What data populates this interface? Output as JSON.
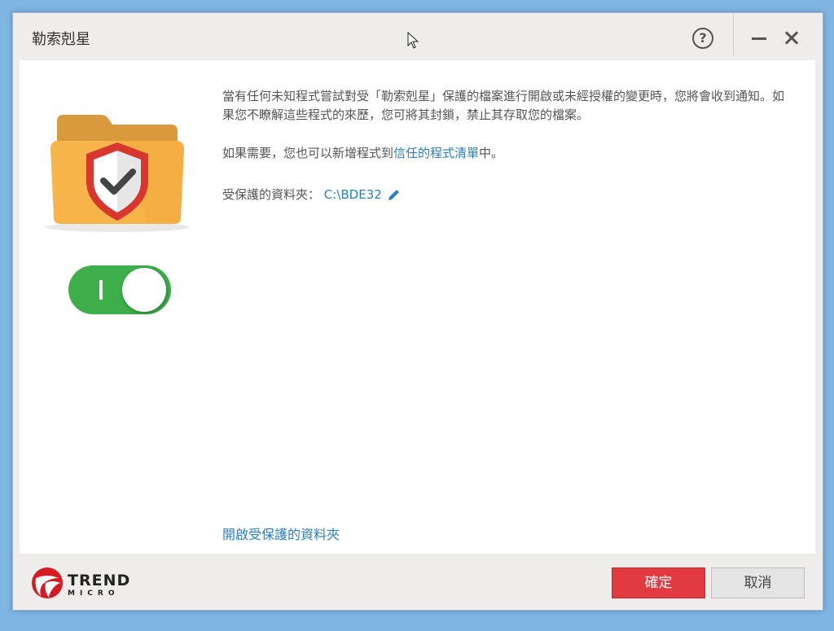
{
  "window": {
    "title": "勒索剋星"
  },
  "titlebar": {
    "help_icon": "question-circle-icon",
    "help_label": "?",
    "minimize_icon": "minimize-icon",
    "close_icon": "close-icon"
  },
  "main": {
    "description": "當有任何未知程式嘗試對受「勒索剋星」保護的檔案進行開啟或未經授權的變更時，您將會收到通知。如果您不瞭解這些程式的來歷，您可將其封鎖，禁止其存取您的檔案。",
    "more_prefix": "如果需要，您也可以新增程式到",
    "trusted_link": "信任的程式清單",
    "more_suffix": "中。",
    "folder_label": "受保護的資料夾：",
    "folder_path": "C:\\BDE32",
    "open_link": "開啟受保護的資料夾",
    "toggle_mark": "I"
  },
  "footer": {
    "logo_line1": "TREND",
    "logo_line2": "MICRO",
    "ok_label": "確定",
    "cancel_label": "取消"
  },
  "colors": {
    "accent": "#2a7fc1",
    "toggle_on": "#3dae49",
    "ok_button": "#e23a41",
    "folder": "#f7b44a",
    "shield_red": "#d7372f"
  }
}
